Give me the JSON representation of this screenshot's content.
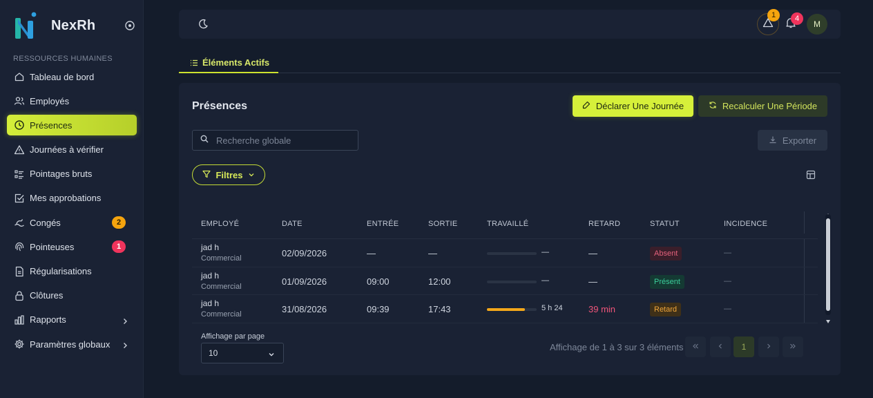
{
  "brand": {
    "name": "NexRh",
    "logo_icon": "nexrh-logo",
    "toggle_icon": "target-icon"
  },
  "sidebar": {
    "section_title": "RESSOURCES HUMAINES",
    "items": [
      {
        "label": "Tableau de bord",
        "icon": "home-icon"
      },
      {
        "label": "Employés",
        "icon": "users-icon"
      },
      {
        "label": "Présences",
        "icon": "clock-icon",
        "active": true
      },
      {
        "label": "Journées à vérifier",
        "icon": "warning-icon"
      },
      {
        "label": "Pointages bruts",
        "icon": "list-icon"
      },
      {
        "label": "Mes approbations",
        "icon": "check-square-icon"
      },
      {
        "label": "Congés",
        "icon": "vacation-icon",
        "badge": "2"
      },
      {
        "label": "Pointeuses",
        "icon": "fingerprint-icon",
        "badge": "1"
      },
      {
        "label": "Régularisations",
        "icon": "document-icon"
      },
      {
        "label": "Clôtures",
        "icon": "lock-icon"
      },
      {
        "label": "Rapports",
        "icon": "chart-icon",
        "expandable": true
      },
      {
        "label": "Paramètres globaux",
        "icon": "gear-icon",
        "expandable": true
      }
    ]
  },
  "topbar": {
    "theme_icon": "moon-icon",
    "alerts_badge": "1",
    "notifications_badge": "4",
    "avatar_initial": "M"
  },
  "tabs": [
    {
      "label": "Éléments Actifs",
      "icon": "list-icon",
      "active": true
    }
  ],
  "card": {
    "title": "Présences",
    "declare_button": "Déclarer Une Journée",
    "recalc_button": "Recalculer Une Période",
    "search_placeholder": "Recherche globale",
    "export_button": "Exporter",
    "filter_button": "Filtres"
  },
  "table": {
    "headers": [
      "EMPLOYÉ",
      "DATE",
      "ENTRÉE",
      "SORTIE",
      "TRAVAILLÉ",
      "RETARD",
      "STATUT",
      "INCIDENCE"
    ],
    "rows": [
      {
        "name": "jad h",
        "role": "Commercial",
        "date": "02/09/2026",
        "entree": "—",
        "sortie": "—",
        "worked_fraction": 0,
        "worked_label": "—",
        "retard": "—",
        "statut": "Absent",
        "incidence": "—"
      },
      {
        "name": "jad h",
        "role": "Commercial",
        "date": "01/09/2026",
        "entree": "09:00",
        "sortie": "12:00",
        "worked_fraction": 0,
        "worked_label": "—",
        "retard": "—",
        "statut": "Présent",
        "incidence": "—"
      },
      {
        "name": "jad h",
        "role": "Commercial",
        "date": "31/08/2026",
        "entree": "09:39",
        "sortie": "17:43",
        "worked_fraction": 0.77,
        "worked_label": "5 h 24",
        "retard": "39 min",
        "statut": "Retard",
        "incidence": "—"
      }
    ]
  },
  "pagination": {
    "per_page_label": "Affichage par page",
    "per_page_value": "10",
    "info": "Affichage de 1 à 3 sur 3 éléments",
    "current_page": "1"
  },
  "colors": {
    "accent": "#d6f03a",
    "background": "#141c2b",
    "panel": "#1a2234",
    "status_absent": "#e4617c",
    "status_present": "#3ccf9c",
    "status_late": "#f1a73a"
  }
}
